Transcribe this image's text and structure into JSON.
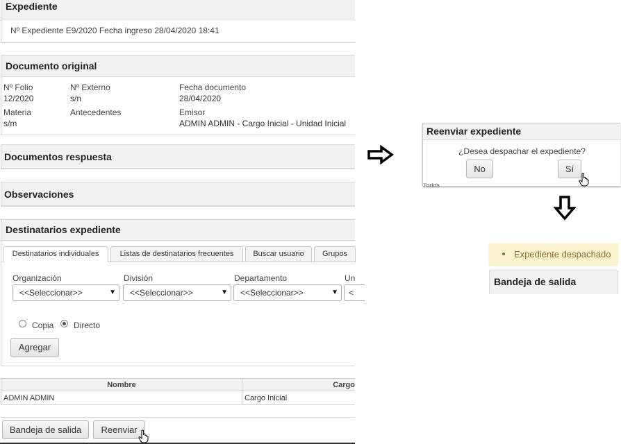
{
  "expediente": {
    "title": "Expediente",
    "numero_label": "Nº Expediente",
    "numero": "E9/2020",
    "fecha_label": "Fecha ingreso",
    "fecha": "28/04/2020 18:41"
  },
  "documento": {
    "title": "Documento original",
    "folio_label": "Nº Folio",
    "folio": "12/2020",
    "externo_label": "Nº Externo",
    "externo": "s/n",
    "fecha_label": "Fecha documento",
    "fecha": "28/04/2020",
    "materia_label": "Materia",
    "materia": "s/m",
    "antecedentes_label": "Antecedentes",
    "emisor_label": "Emisor",
    "emisor": "ADMIN ADMIN - Cargo Inicial - Unidad Inicial"
  },
  "respuesta": {
    "title": "Documentos respuesta"
  },
  "observaciones": {
    "title": "Observaciones"
  },
  "destinatarios": {
    "title": "Destinatarios expediente",
    "tabs": [
      "Destinatarios individuales",
      "Listas de destinatarios frecuentes",
      "Buscar usuario",
      "Grupos"
    ],
    "filters": [
      {
        "label": "Organización",
        "value": "<<Seleccionar>>"
      },
      {
        "label": "División",
        "value": "<<Seleccionar>>"
      },
      {
        "label": "Departamento",
        "value": "<<Seleccionar>>"
      },
      {
        "label": "Un",
        "value": "<"
      }
    ],
    "copia_label": "Copia",
    "directo_label": "Directo",
    "agregar_label": "Agregar"
  },
  "tabla": {
    "headers": [
      "Nombre",
      "Cargo"
    ],
    "rows": [
      [
        "ADMIN ADMIN",
        "Cargo Inicial"
      ]
    ]
  },
  "footer": {
    "bandeja_label": "Bandeja de salida",
    "reenviar_label": "Reenviar"
  },
  "dialog": {
    "title": "Reenviar expediente",
    "question": "¿Desea despachar el expediente?",
    "no_label": "No",
    "si_label": "Sí",
    "peek": "Todos"
  },
  "result": {
    "message": "Expediente despachado",
    "bandeja_title": "Bandeja de salida"
  },
  "colors": {
    "notice_bg": "#fcf3cf",
    "notice_text": "#8a6d3b",
    "panel_header": "#f2f2f2"
  }
}
